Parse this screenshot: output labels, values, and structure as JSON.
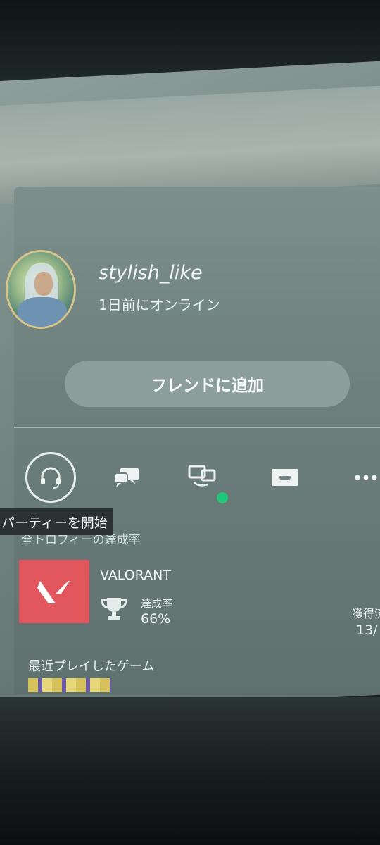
{
  "profile": {
    "username": "stylish_like",
    "status": "1日前にオンライン",
    "add_friend_label": "フレンドに追加"
  },
  "actions": {
    "tooltip": "パーティーを開始",
    "icons": [
      "headset-icon",
      "chat-icon",
      "remote-play-icon",
      "share-screen-icon",
      "more-icon"
    ]
  },
  "trophies": {
    "heading": "全トロフィーの達成率",
    "game_title": "VALORANT",
    "rate_label": "達成率",
    "rate_value": "66%",
    "acquired_label": "獲得済",
    "acquired_value": "13/"
  },
  "recent": {
    "heading": "最近プレイしたゲーム"
  },
  "colors": {
    "online_dot": "#22c87a",
    "valorant_red": "#e2575e",
    "tooltip_bg": "#2a3233"
  }
}
